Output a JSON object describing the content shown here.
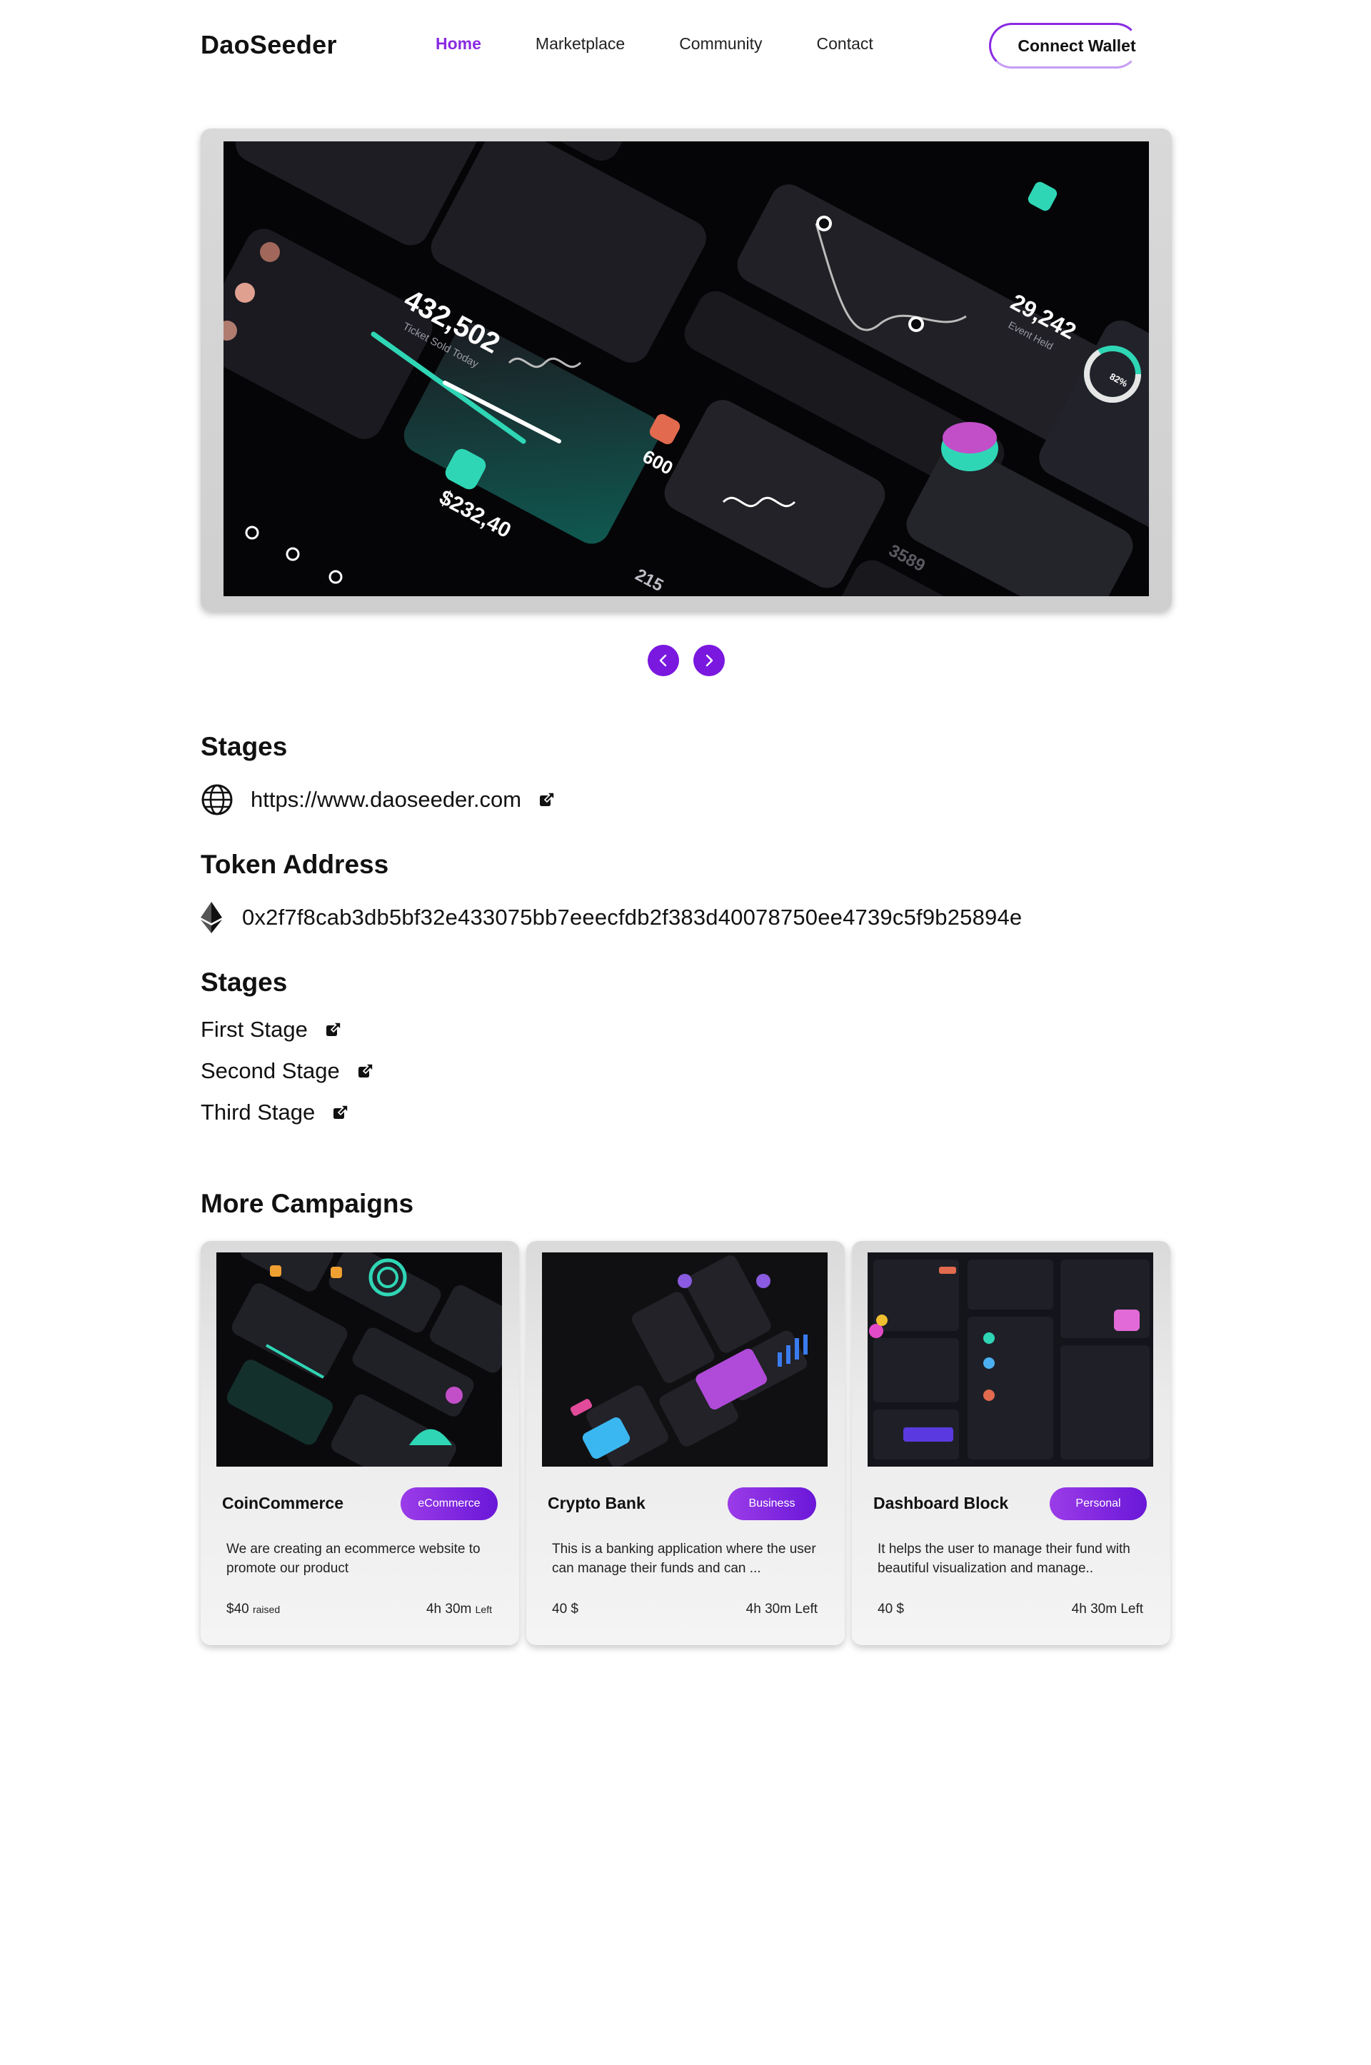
{
  "nav": {
    "brand": "DaoSeeder",
    "links": [
      {
        "label": "Home",
        "active": true
      },
      {
        "label": "Marketplace",
        "active": false
      },
      {
        "label": "Community",
        "active": false
      },
      {
        "label": "Contact",
        "active": false
      }
    ],
    "connect_label": "Connect Wallet"
  },
  "hero": {
    "image_alt": "dashboard-ui-illustration",
    "stats": {
      "tickets": "432,502",
      "tickets_label": "Ticket Sold Today",
      "event": "29,242",
      "event_label": "Event Held",
      "amount": "$232,40",
      "count": "600",
      "small": "215",
      "other": "3589",
      "percent": "82%"
    },
    "prev_icon": "chevron-left-icon",
    "next_icon": "chevron-right-icon"
  },
  "website": {
    "heading": "Stages",
    "url": "https://www.daoseeder.com",
    "icon": "globe-icon"
  },
  "token": {
    "heading": "Token Address",
    "address": "0x2f7f8cab3db5bf32e433075bb7eeecfdb2f383d40078750ee4739c5f9b25894e",
    "icon": "ethereum-icon"
  },
  "stages": {
    "heading": "Stages",
    "items": [
      "First Stage",
      "Second Stage",
      "Third Stage"
    ]
  },
  "campaigns": {
    "heading": "More Campaigns",
    "cards": [
      {
        "title": "CoinCommerce",
        "badge": "eCommerce",
        "desc": "We are creating an ecommerce website to promote our product",
        "raised": "$40",
        "raised_suffix": "raised",
        "time": "4h 30m",
        "time_suffix": "Left"
      },
      {
        "title": "Crypto Bank",
        "badge": "Business",
        "desc": "This is a banking application where the user can manage their funds and can ...",
        "raised": "40 $",
        "raised_suffix": "",
        "time": "4h 30m Left",
        "time_suffix": ""
      },
      {
        "title": "Dashboard Block",
        "badge": "Personal",
        "desc": "It helps the user to manage their fund with beautiful visualization and manage..",
        "raised": "40 $",
        "raised_suffix": "",
        "time": "4h 30m Left",
        "time_suffix": ""
      }
    ]
  },
  "colors": {
    "accent": "#8a2be2",
    "button": "#7a18e0",
    "teal": "#2fd6b5"
  }
}
